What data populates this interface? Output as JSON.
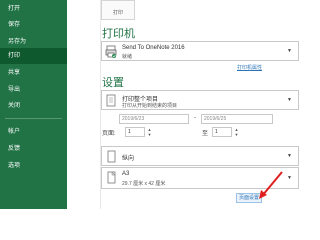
{
  "sidebar": {
    "items": [
      {
        "label": "打开"
      },
      {
        "label": "保存"
      },
      {
        "label": "另存为"
      },
      {
        "label": "打印"
      },
      {
        "label": "共享"
      },
      {
        "label": "导出"
      },
      {
        "label": "关闭"
      },
      {
        "label": "帐户"
      },
      {
        "label": "反馈"
      },
      {
        "label": "选项"
      }
    ],
    "active": "打印",
    "color": "#217346",
    "active_color": "#0e5a2e"
  },
  "print_button": {
    "label": "打印"
  },
  "printer": {
    "title": "打印机",
    "name": "Send To OneNote 2016",
    "status": "就绪",
    "properties_link": "打印机属性"
  },
  "settings": {
    "title": "设置",
    "scope": {
      "line1": "打印整个项目",
      "line2": "打印从开始到结束的项目"
    },
    "date_start": "2019/6/23",
    "date_end": "2019/6/25",
    "date_separator": "-",
    "pages_label": "页面:",
    "pages_from": "1",
    "pages_to_label": "至",
    "pages_to": "1",
    "orientation": "纵向",
    "paper": {
      "line1": "A3",
      "line2": "29.7 厘米 x 42 厘米"
    },
    "next_button": "页面设置"
  },
  "accent_color": "#217346",
  "link_color": "#2e75b6",
  "annotation_color": "#e02020"
}
